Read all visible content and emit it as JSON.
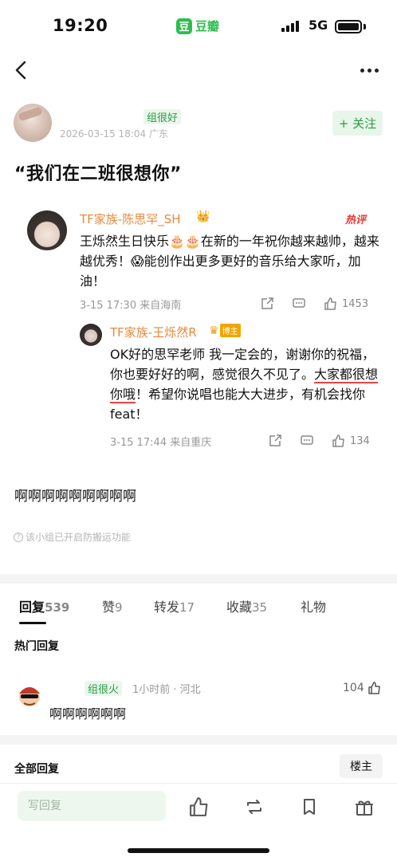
{
  "status_bar": {
    "time": "19:20",
    "app_logo": "豆",
    "app_name": "豆瓣",
    "network": "5G"
  },
  "nav": {
    "back_icon": "chevron-left-icon",
    "more_icon": "more-dots-icon"
  },
  "post": {
    "group_tag": "组很好",
    "meta": "2026-03-15 18:04 广东",
    "follow_label": "+ 关注",
    "title": "“我们在二班很想你”",
    "body": "啊啊啊啊啊啊啊啊啊",
    "notice": "该小组已开启防搬运功能"
  },
  "quoted_comment": {
    "author": "TF家族-陈思罕_SH",
    "hot_label": "热评",
    "text": "王烁然生日快乐🎂🎂在新的一年祝你越来越帅，越来越优秀！😱能创作出更多更好的音乐给大家听，加油！",
    "meta": "3-15 17:30 来自海南",
    "likes": "1453",
    "reply": {
      "author": "TF家族-王烁然R",
      "owner_badge": "博主",
      "text_before": "OK好的思罕老师 我一定会的，谢谢你的祝福，你也要好好的啊，感觉很久不见了。",
      "text_underlined": "大家都很想你哦",
      "text_after": "！希望你说唱也能大大进步，有机会找你feat！",
      "meta": "3-15 17:44 来自重庆",
      "likes": "134"
    }
  },
  "tabs": [
    {
      "label": "回复",
      "count": "539"
    },
    {
      "label": "赞",
      "count": "9"
    },
    {
      "label": "转发",
      "count": "17"
    },
    {
      "label": "收藏",
      "count": "35"
    },
    {
      "label": "礼物",
      "count": ""
    }
  ],
  "hot_replies": {
    "section_title": "热门回复",
    "items": [
      {
        "group_tag": "组很火",
        "meta": "1小时前 · 河北",
        "likes": "104",
        "text": "啊啊啊啊啊啊"
      }
    ]
  },
  "all_replies": {
    "section_title": "全部回复",
    "filter_label": "楼主"
  },
  "bottom_bar": {
    "reply_placeholder": "写回复"
  },
  "colors": {
    "brand_green": "#2dbd4e",
    "name_orange": "#e8883a",
    "hot_red": "#e53935"
  }
}
